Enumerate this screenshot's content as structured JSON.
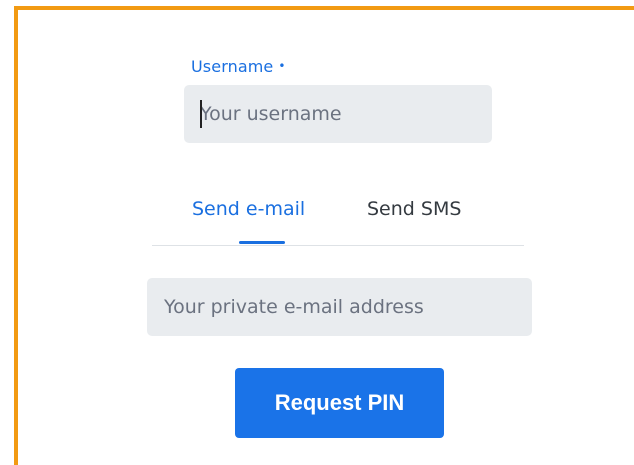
{
  "form": {
    "username": {
      "label": "Username",
      "required_marker": "•",
      "placeholder": "Your username",
      "value": ""
    },
    "tabs": [
      {
        "label": "Send e-mail",
        "active": true
      },
      {
        "label": "Send SMS",
        "active": false
      }
    ],
    "email": {
      "placeholder": "Your private e-mail address",
      "value": ""
    },
    "submit_label": "Request PIN"
  },
  "colors": {
    "frame_border": "#f29a12",
    "accent": "#1a6fe0",
    "button": "#1a73e8",
    "input_bg": "#e9ecef"
  }
}
